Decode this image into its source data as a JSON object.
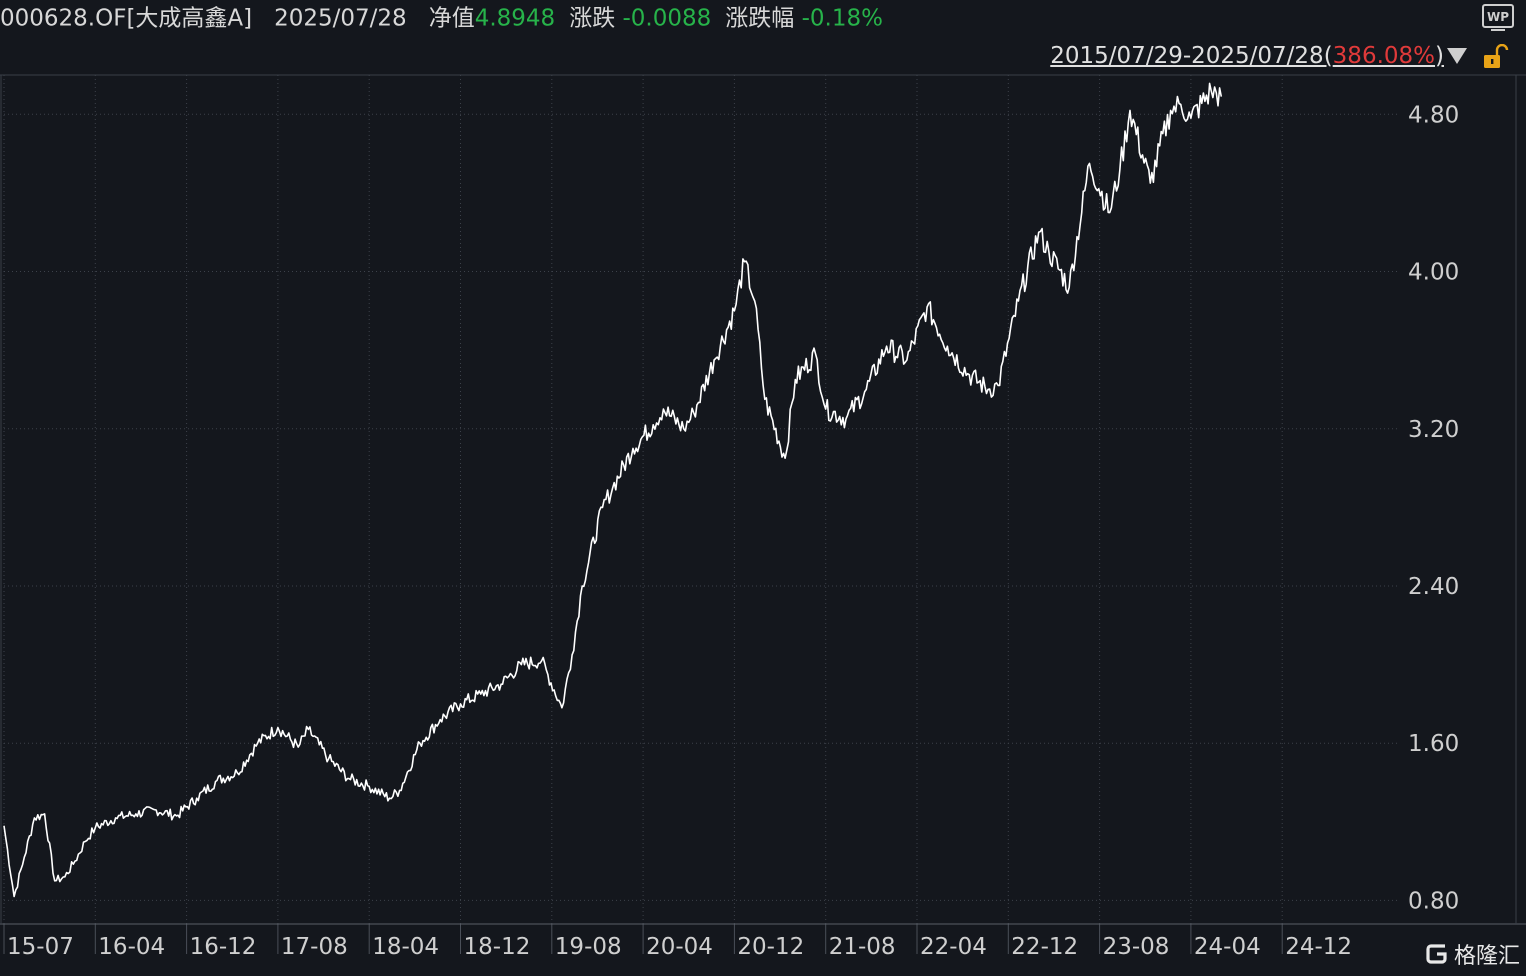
{
  "header": {
    "code": "000628.OF[大成高鑫A]",
    "date": "2025/07/28",
    "nav_label": "净值",
    "nav_value": "4.8948",
    "change_label": "涨跌",
    "change_value": "-0.0088",
    "pct_label": "涨跌幅",
    "pct_value": "-0.18%"
  },
  "range": {
    "dates": "2015/07/29-2025/07/28(",
    "pct": "386.08%",
    "close": ")"
  },
  "icons": {
    "wp": "WP",
    "toggle": "triangle-down-icon",
    "lock": "unlock-icon"
  },
  "colors": {
    "background": "#14171d",
    "line": "#ffffff",
    "down": "#27b34a",
    "up": "#e03a3a",
    "lock": "#e8a317"
  },
  "logo": {
    "text": "格隆汇"
  },
  "chart_data": {
    "type": "line",
    "title": "",
    "xlabel": "",
    "ylabel": "",
    "y_axis_side": "right",
    "ylim": [
      0.68,
      5.0
    ],
    "yticks": [
      "0.80",
      "1.60",
      "2.40",
      "3.20",
      "4.00",
      "4.80"
    ],
    "yticks_values": [
      0.8,
      1.6,
      2.4,
      3.2,
      4.0,
      4.8
    ],
    "xticks": [
      "15-07",
      "16-04",
      "16-12",
      "17-08",
      "18-04",
      "18-12",
      "19-08",
      "20-04",
      "20-12",
      "21-08",
      "22-04",
      "22-12",
      "23-08",
      "24-04",
      "24-12"
    ],
    "grid": true,
    "series": [
      {
        "values_note": "",
        "x": [
          "2015-07",
          "2015-08",
          "2015-09",
          "2015-10",
          "2015-11",
          "2015-12",
          "2016-01",
          "2016-02",
          "2016-03",
          "2016-04",
          "2016-06",
          "2016-08",
          "2016-10",
          "2016-12",
          "2017-02",
          "2017-04",
          "2017-06",
          "2017-08",
          "2017-10",
          "2017-12",
          "2018-01",
          "2018-03",
          "2018-05",
          "2018-07",
          "2018-09",
          "2018-10",
          "2018-12",
          "2019-02",
          "2019-04",
          "2019-06",
          "2019-08",
          "2019-10",
          "2019-12",
          "2020-02",
          "2020-03",
          "2020-04",
          "2020-06",
          "2020-07",
          "2020-09",
          "2020-11",
          "2020-12",
          "2021-02",
          "2021-03",
          "2021-05",
          "2021-07",
          "2021-08",
          "2021-09",
          "2021-10",
          "2021-12",
          "2022-01",
          "2022-03",
          "2022-04",
          "2022-06",
          "2022-08",
          "2022-10",
          "2022-12",
          "2023-02",
          "2023-04",
          "2023-06",
          "2023-08",
          "2023-09",
          "2023-11",
          "2024-01",
          "2024-02",
          "2024-04",
          "2024-06",
          "2024-08",
          "2024-09",
          "2024-10",
          "2024-12",
          "2025-02",
          "2025-03",
          "2025-04",
          "2025-06",
          "2025-07"
        ],
        "y": [
          1.18,
          0.82,
          1.02,
          1.22,
          1.24,
          0.9,
          0.92,
          1.0,
          1.1,
          1.17,
          1.22,
          1.24,
          1.26,
          1.23,
          1.32,
          1.41,
          1.45,
          1.6,
          1.68,
          1.58,
          1.67,
          1.52,
          1.42,
          1.38,
          1.32,
          1.36,
          1.6,
          1.72,
          1.8,
          1.85,
          1.9,
          2.0,
          2.02,
          1.78,
          2.05,
          2.4,
          2.8,
          2.9,
          3.1,
          3.22,
          3.3,
          3.2,
          3.28,
          3.55,
          3.8,
          4.05,
          3.85,
          3.35,
          3.05,
          3.45,
          3.58,
          3.3,
          3.25,
          3.4,
          3.62,
          3.55,
          3.82,
          3.62,
          3.48,
          3.4,
          3.42,
          3.85,
          4.2,
          4.1,
          3.92,
          4.55,
          4.3,
          4.52,
          4.82,
          4.45,
          4.82,
          4.85,
          4.78,
          4.92,
          4.89
        ]
      }
    ]
  }
}
